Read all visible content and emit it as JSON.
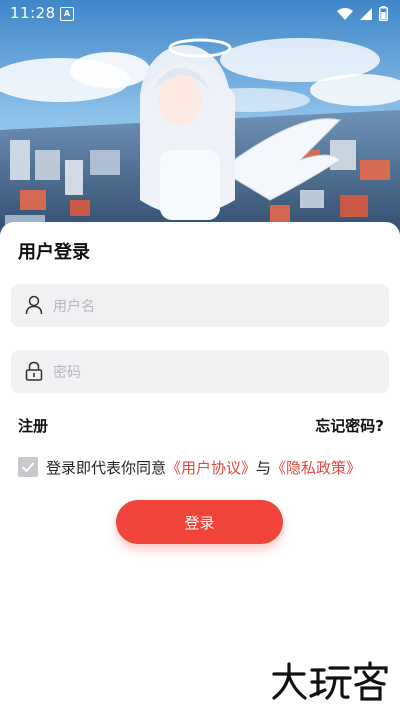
{
  "status_bar": {
    "time": "11:28",
    "app_icon_glyph": "A",
    "icons": [
      "wifi-icon",
      "signal-icon",
      "battery-icon"
    ]
  },
  "hero": {
    "description_icon": "angel-girl-illustration"
  },
  "login": {
    "title": "用户登录",
    "username": {
      "placeholder": "用户名",
      "value": "",
      "icon": "user-icon"
    },
    "password": {
      "placeholder": "密码",
      "value": "",
      "icon": "lock-icon"
    },
    "register_label": "注册",
    "forgot_label": "忘记密码?",
    "agreement": {
      "checked": true,
      "prefix": "登录即代表你同意",
      "user_agreement": "《用户协议》",
      "conjunction": "与",
      "privacy_policy": "《隐私政策》"
    },
    "submit_label": "登录"
  },
  "colors": {
    "accent": "#f0443a",
    "link": "#e8453c",
    "field_bg": "#f1f1f3",
    "checkbox": "#c8c8cc"
  },
  "watermark": {
    "text": "大玩客"
  }
}
